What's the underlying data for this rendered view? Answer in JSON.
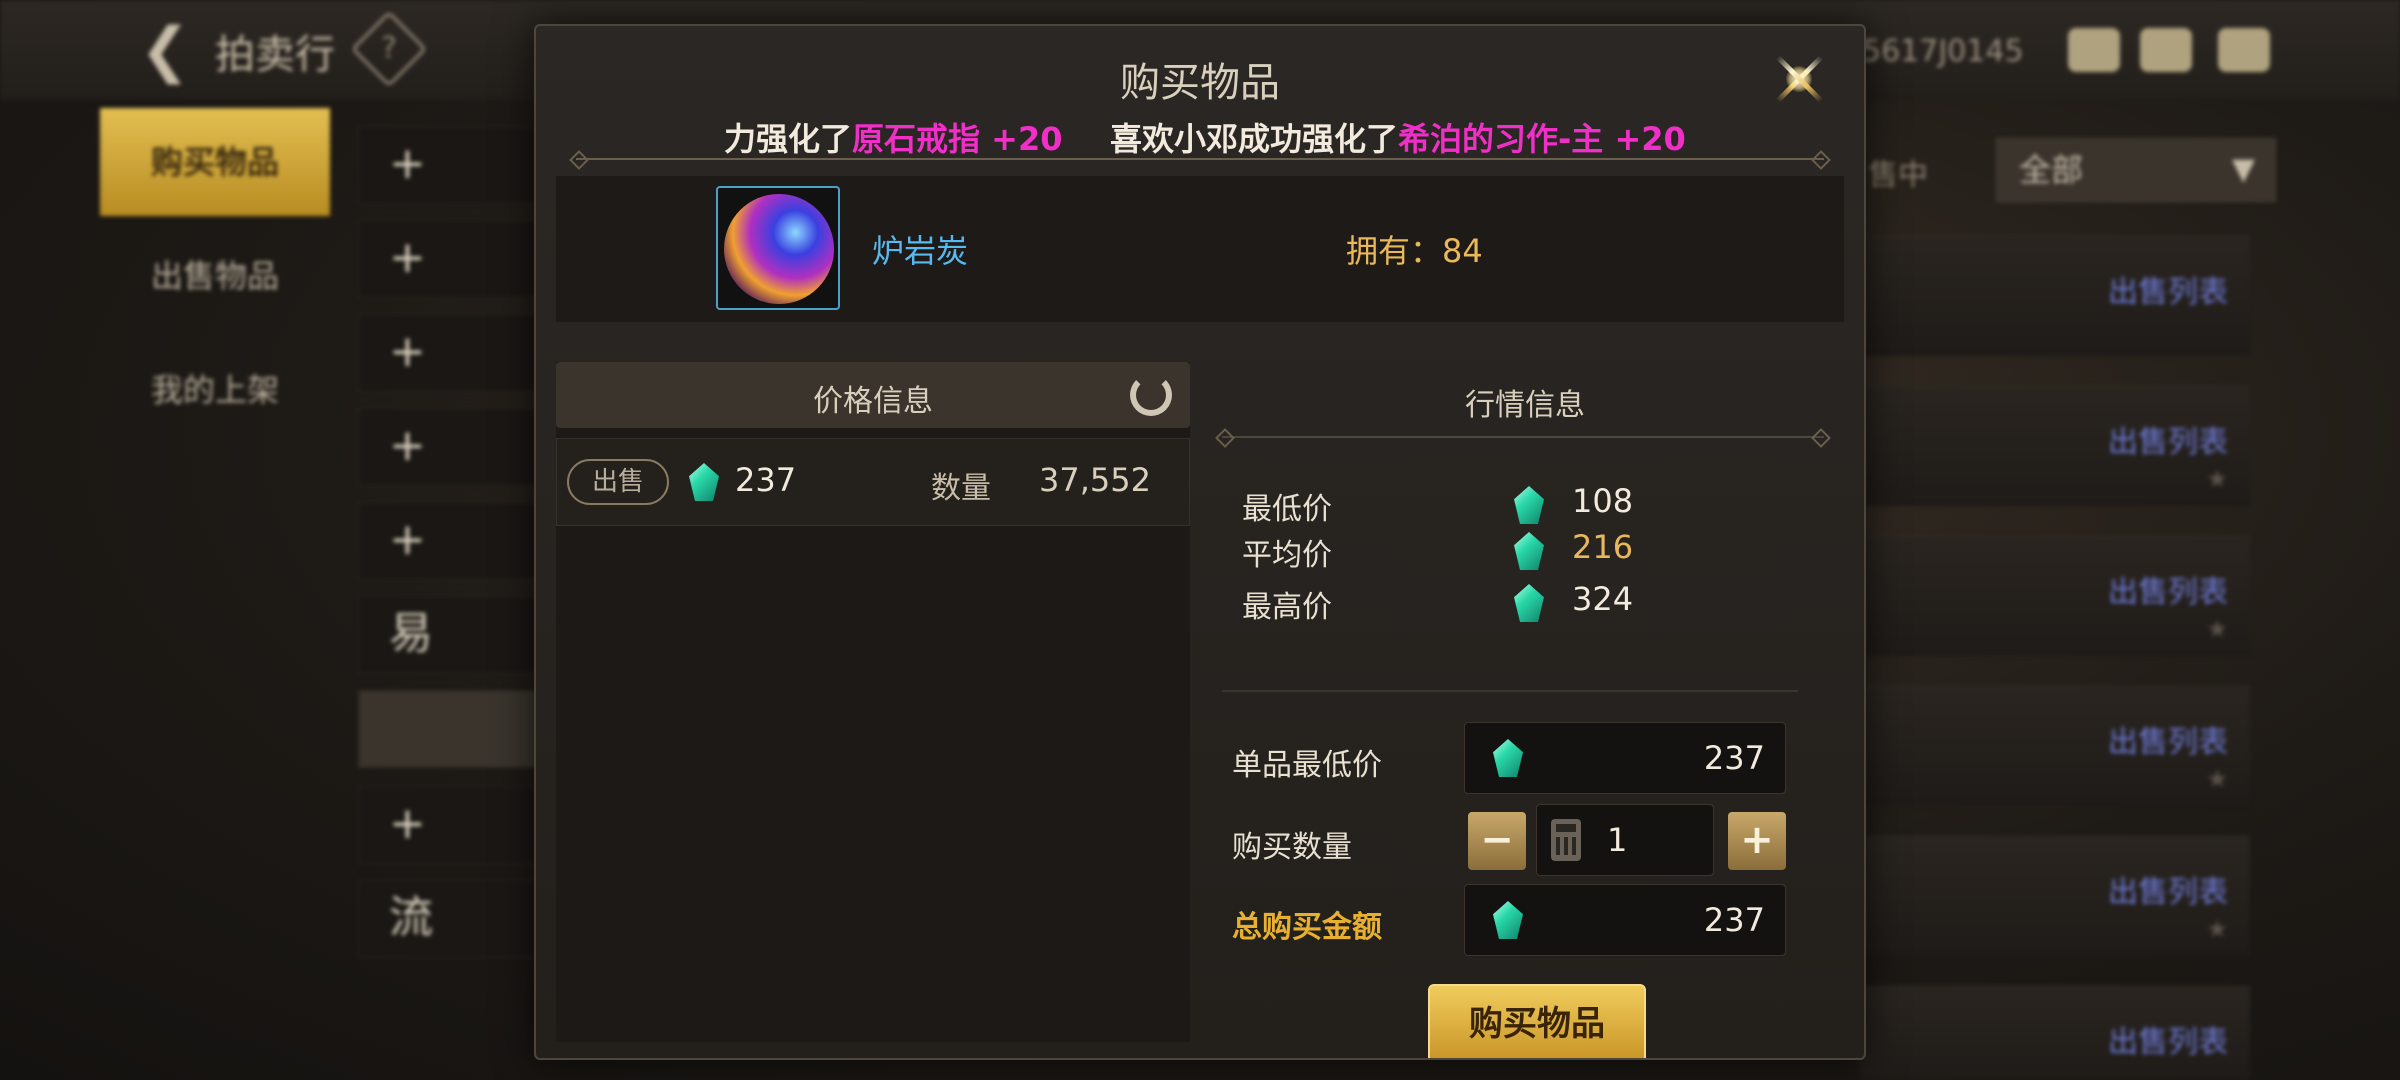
{
  "background": {
    "page_title": "拍卖行",
    "currency_amount": "5617J0145",
    "side_tabs": [
      {
        "label": "购买物品",
        "active": true
      },
      {
        "label": "出售物品",
        "active": false
      },
      {
        "label": "我的上架",
        "active": false
      }
    ],
    "category_rows": [
      "+",
      "+",
      "+",
      "+",
      "+",
      "易",
      "",
      "+",
      "流"
    ],
    "filter_label": "售中",
    "filter_value": "全部",
    "list_link": "出售列表",
    "list_links": [
      "出售列表",
      "出售列表",
      "出售列表",
      "出售列表",
      "出售列表",
      "出售列表"
    ]
  },
  "modal": {
    "title": "购买物品",
    "ticker": {
      "seg1_prefix": "力强化了",
      "seg1_item": "原石戒指 +20",
      "seg2_prefix": "喜欢小邓成功强化了",
      "seg2_item": "希泊的习作-主 +20"
    },
    "item": {
      "name": "炉岩炭",
      "owned_label": "拥有：",
      "owned_value": "84"
    },
    "price_info": {
      "header": "价格信息",
      "rows": [
        {
          "tag": "出售",
          "price": "237",
          "qty_label": "数量",
          "qty": "37,552"
        }
      ]
    },
    "market": {
      "header": "行情信息",
      "stats": [
        {
          "label": "最低价",
          "value": "108"
        },
        {
          "label": "平均价",
          "value": "216"
        },
        {
          "label": "最高价",
          "value": "324"
        }
      ]
    },
    "form": {
      "unit_price_label": "单品最低价",
      "unit_price": "237",
      "qty_label": "购买数量",
      "qty": "1",
      "minus": "−",
      "plus": "+",
      "total_label": "总购买金额",
      "total": "237"
    },
    "buy_button": "购买物品"
  },
  "colors": {
    "accent_gold": "#e8b030",
    "highlight_magenta": "#f02fc8",
    "item_blue": "#58b8f0",
    "link_blue": "#6e7ad6"
  },
  "icons": [
    "back-arrow-icon",
    "help-diamond-icon",
    "close-icon",
    "refresh-icon",
    "gem-icon",
    "calculator-icon",
    "dropdown-arrow-icon"
  ]
}
